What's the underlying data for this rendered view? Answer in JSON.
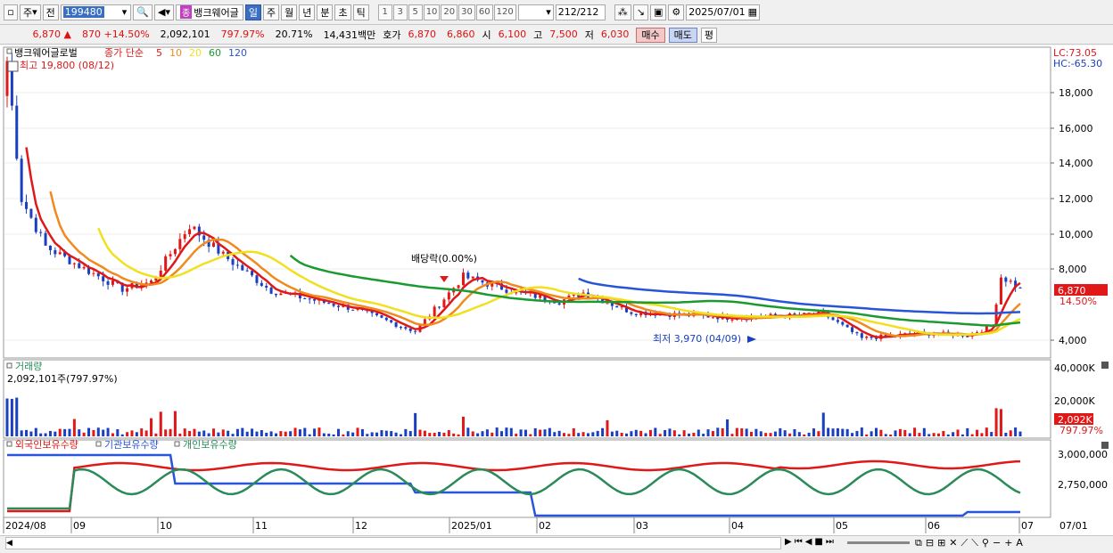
{
  "toolbar": {
    "market_type": "주",
    "prev_label": "전",
    "code": "199480",
    "stock_tag": "종",
    "stock_name": "뱅크웨어글",
    "periods": [
      "일",
      "주",
      "월",
      "년",
      "분",
      "초",
      "틱"
    ],
    "active_period": "일",
    "intervals": [
      "1",
      "3",
      "5",
      "10",
      "20",
      "30",
      "60",
      "120"
    ],
    "count": "212",
    "count_total": "/212",
    "date": "2025/07/01"
  },
  "quote": {
    "price": "6,870",
    "arrow": "▲",
    "change": "870",
    "change_pct": "+14.50%",
    "volume": "2,092,101",
    "vol_pct": "797.97%",
    "turnover": "20.71%",
    "amount": "14,431백만",
    "ask_label": "호가",
    "ask": "6,870",
    "bid": "6,860",
    "open_label": "시",
    "open": "6,100",
    "high_label": "고",
    "high": "7,500",
    "low_label": "저",
    "low": "6,030",
    "buy_label": "매수",
    "sell_label": "매도",
    "avg_label": "평"
  },
  "price_panel": {
    "legend_name": "뱅크웨어글로벌",
    "legend_type": "종가 단순",
    "ma_labels": [
      "5",
      "10",
      "20",
      "60",
      "120"
    ],
    "ma_colors": [
      "#e01818",
      "#f08a1c",
      "#f0e020",
      "#1a9a30",
      "#2855d8"
    ],
    "high_note": "최고 19,800 (08/12)",
    "low_note": "최저 3,970 (04/09)",
    "dividend_note": "배당락(0.00%)",
    "lc": "LC:73.05",
    "hc": "HC:-65.30",
    "y_ticks": [
      "18,000",
      "16,000",
      "14,000",
      "12,000",
      "10,000",
      "8,000",
      "4,000"
    ],
    "price_tag": "6,870",
    "pct_tag": "14.50%"
  },
  "volume_panel": {
    "title": "거래량",
    "value": "2,092,101주(797.97%)",
    "y_ticks": [
      "40,000K",
      "20,000K"
    ],
    "tag": "2,092K",
    "tag_pct": "797.97%"
  },
  "holding_panel": {
    "labels": [
      "외국인보유수량",
      "기관보유수량",
      "개인보유수량"
    ],
    "colors": [
      "#e01818",
      "#2855d8",
      "#2a8a5a"
    ],
    "y_ticks": [
      "3,000,000",
      "2,750,000"
    ]
  },
  "x_axis": [
    "2024/08",
    "09",
    "10",
    "11",
    "12",
    "2025/01",
    "02",
    "03",
    "04",
    "05",
    "06",
    "07"
  ],
  "x_axis_right": "07/01",
  "colors": {
    "up": "#e01818",
    "down": "#1a3fbf",
    "accent": "#3a6fc4"
  }
}
